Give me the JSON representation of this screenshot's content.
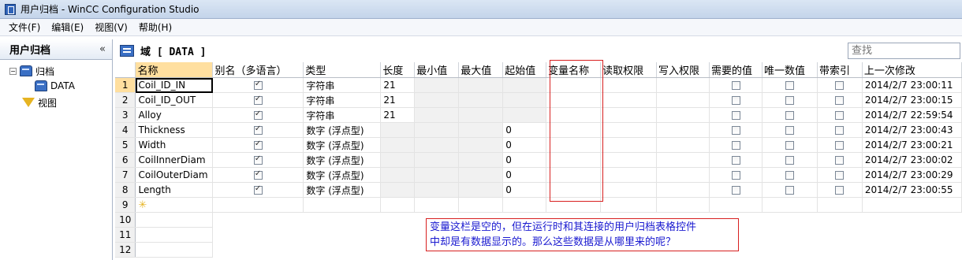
{
  "window": {
    "title": "用户归档 - WinCC Configuration Studio"
  },
  "menu": [
    "文件(F)",
    "编辑(E)",
    "视图(V)",
    "帮助(H)"
  ],
  "tree": {
    "header": "用户归档",
    "collapse": "«",
    "items": [
      {
        "label": "归档",
        "icon": "database-icon",
        "expander": "−"
      },
      {
        "label": "DATA",
        "icon": "database-icon"
      },
      {
        "label": "视图",
        "icon": "view-filter-icon"
      }
    ]
  },
  "domain": {
    "title": "域 [ DATA ]"
  },
  "search": {
    "placeholder": "查找"
  },
  "grid": {
    "columns": [
      "名称",
      "别名（多语言）",
      "类型",
      "长度",
      "最小值",
      "最大值",
      "起始值",
      "变量名称",
      "读取权限",
      "写入权限",
      "需要的值",
      "唯一数值",
      "带索引",
      "上一次修改"
    ],
    "rows": [
      {
        "num": "1",
        "name": "Coil_ID_IN",
        "alias": true,
        "type": "字符串",
        "length": "21",
        "start": "",
        "required": false,
        "unique": false,
        "indexed": false,
        "modified": "2014/2/7 23:00:11"
      },
      {
        "num": "2",
        "name": "Coil_ID_OUT",
        "alias": true,
        "type": "字符串",
        "length": "21",
        "start": "",
        "required": false,
        "unique": false,
        "indexed": false,
        "modified": "2014/2/7 23:00:15"
      },
      {
        "num": "3",
        "name": "Alloy",
        "alias": true,
        "type": "字符串",
        "length": "21",
        "start": "",
        "required": false,
        "unique": false,
        "indexed": false,
        "modified": "2014/2/7 22:59:54"
      },
      {
        "num": "4",
        "name": "Thickness",
        "alias": true,
        "type": "数字 (浮点型)",
        "length": "",
        "start": "0",
        "required": false,
        "unique": false,
        "indexed": false,
        "modified": "2014/2/7 23:00:43"
      },
      {
        "num": "5",
        "name": "Width",
        "alias": true,
        "type": "数字 (浮点型)",
        "length": "",
        "start": "0",
        "required": false,
        "unique": false,
        "indexed": false,
        "modified": "2014/2/7 23:00:21"
      },
      {
        "num": "6",
        "name": "CoilInnerDiam",
        "alias": true,
        "type": "数字 (浮点型)",
        "length": "",
        "start": "0",
        "required": false,
        "unique": false,
        "indexed": false,
        "modified": "2014/2/7 23:00:02"
      },
      {
        "num": "7",
        "name": "CoilOuterDiam",
        "alias": true,
        "type": "数字 (浮点型)",
        "length": "",
        "start": "0",
        "required": false,
        "unique": false,
        "indexed": false,
        "modified": "2014/2/7 23:00:29"
      },
      {
        "num": "8",
        "name": "Length",
        "alias": true,
        "type": "数字 (浮点型)",
        "length": "",
        "start": "0",
        "required": false,
        "unique": false,
        "indexed": false,
        "modified": "2014/2/7 23:00:55"
      }
    ],
    "empty_rows": [
      "9",
      "10",
      "11",
      "12"
    ]
  },
  "annotation": {
    "line1": "变量这栏是空的，但在运行时和其连接的用户归档表格控件",
    "line2": "中却是有数据显示的。那么这些数据是从哪里来的呢？"
  },
  "colors": {
    "selected_header": "#ffdf9f",
    "annotation_border": "#d82020",
    "annotation_text": "#1a1ad0"
  }
}
